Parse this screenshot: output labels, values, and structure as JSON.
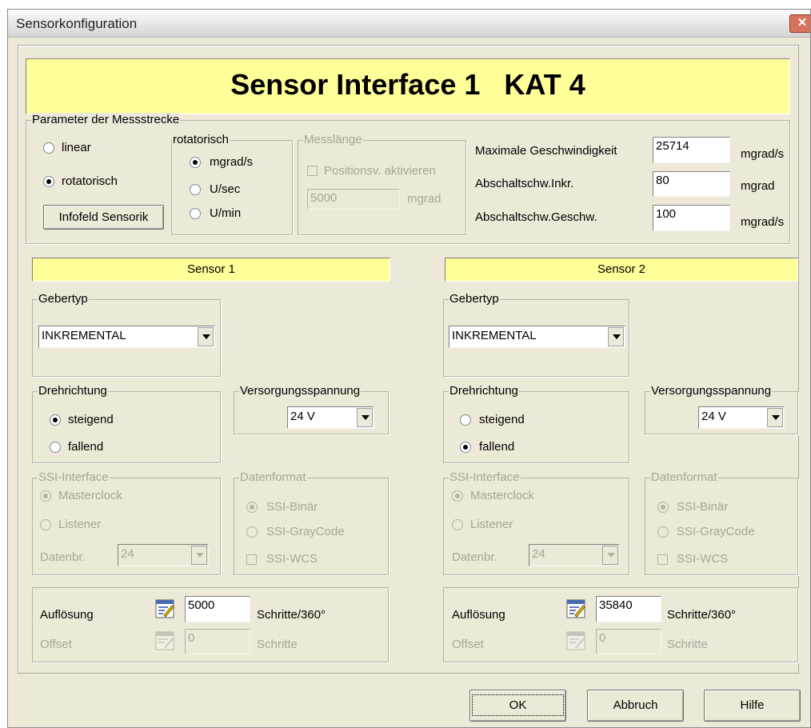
{
  "window": {
    "title": "Sensorkonfiguration",
    "close_glyph": "✕"
  },
  "banner": {
    "title": "Sensor Interface 1   KAT 4"
  },
  "params": {
    "group_label": "Parameter der Messstrecke",
    "linear": "linear",
    "rotatorisch": "rotatorisch",
    "info_button": "Infofeld Sensorik",
    "rot_group_label": "rotatorisch",
    "unit_mgrad_s": "mgrad/s",
    "unit_u_sec": "U/sec",
    "unit_u_min": "U/min",
    "mess_group_label": "Messlänge",
    "pos_activate": "Positionsv. aktivieren",
    "mess_value": "5000",
    "mess_unit": "mgrad",
    "max_speed_label": "Maximale Geschwindigkeit",
    "max_speed_value": "25714",
    "max_speed_unit": "mgrad/s",
    "abs_inkr_label": "Abschaltschw.Inkr.",
    "abs_inkr_value": "80",
    "abs_inkr_unit": "mgrad",
    "abs_speed_label": "Abschaltschw.Geschw.",
    "abs_speed_value": "100",
    "abs_speed_unit": "mgrad/s"
  },
  "sensors": [
    {
      "title": "Sensor 1",
      "gebertyp_label": "Gebertyp",
      "gebertyp_value": "INKREMENTAL",
      "dreh_label": "Drehrichtung",
      "steigend": "steigend",
      "fallend": "fallend",
      "dreh_selected": "steigend",
      "vers_label": "Versorgungsspannung",
      "vers_value": "24 V",
      "ssi_label": "SSI-Interface",
      "masterclock": "Masterclock",
      "listener": "Listener",
      "datenbr_label": "Datenbr.",
      "datenbr_value": "24",
      "df_label": "Datenformat",
      "ssi_binaer": "SSI-Binär",
      "ssi_gray": "SSI-GrayCode",
      "ssi_wcs": "SSI-WCS",
      "aufl_label": "Auflösung",
      "aufl_value": "5000",
      "aufl_unit": "Schritte/360°",
      "offset_label": "Offset",
      "offset_value": "0",
      "offset_unit": "Schritte"
    },
    {
      "title": "Sensor 2",
      "gebertyp_label": "Gebertyp",
      "gebertyp_value": "INKREMENTAL",
      "dreh_label": "Drehrichtung",
      "steigend": "steigend",
      "fallend": "fallend",
      "dreh_selected": "fallend",
      "vers_label": "Versorgungsspannung",
      "vers_value": "24 V",
      "ssi_label": "SSI-Interface",
      "masterclock": "Masterclock",
      "listener": "Listener",
      "datenbr_label": "Datenbr.",
      "datenbr_value": "24",
      "df_label": "Datenformat",
      "ssi_binaer": "SSI-Binär",
      "ssi_gray": "SSI-GrayCode",
      "ssi_wcs": "SSI-WCS",
      "aufl_label": "Auflösung",
      "aufl_value": "35840",
      "aufl_unit": "Schritte/360°",
      "offset_label": "Offset",
      "offset_value": "0",
      "offset_unit": "Schritte"
    }
  ],
  "buttons": {
    "ok": "OK",
    "cancel": "Abbruch",
    "help": "Hilfe"
  }
}
